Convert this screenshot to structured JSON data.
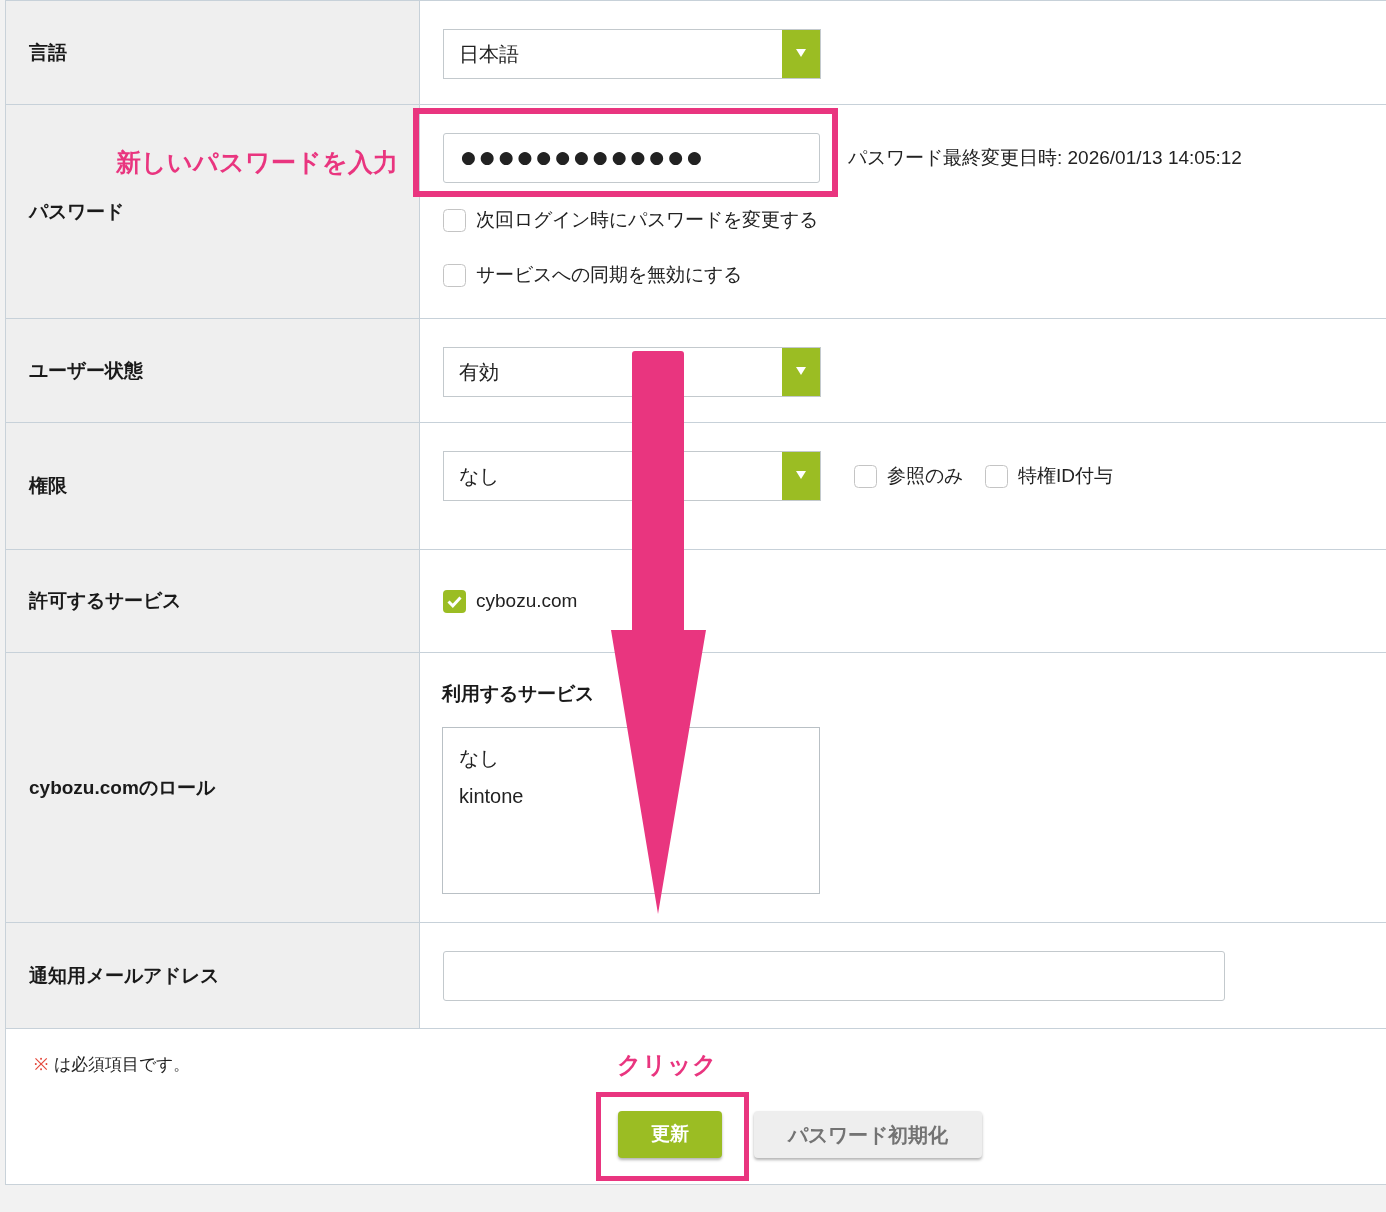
{
  "fields": [
    {
      "kind": "select",
      "label": "言語",
      "value": "日本語"
    },
    {
      "kind": "password",
      "label": "パスワード",
      "value": "●●●●●●●●●●●●●",
      "note": "パスワード最終変更日時: 2026/01/13 14:05:12",
      "options": [
        {
          "label": "次回ログイン時にパスワードを変更する",
          "checked": false
        },
        {
          "label": "サービスへの同期を無効にする",
          "checked": false
        }
      ]
    },
    {
      "kind": "select",
      "label": "ユーザー状態",
      "value": "有効"
    },
    {
      "kind": "select",
      "label": "権限",
      "value": "なし",
      "options": [
        {
          "label": "参照のみ",
          "checked": false
        },
        {
          "label": "特権ID付与",
          "checked": false
        }
      ]
    },
    {
      "kind": "checklist",
      "label": "許可するサービス",
      "options": [
        {
          "label": "cybozu.com",
          "checked": true
        }
      ]
    },
    {
      "kind": "listbox",
      "label": "cybozu.comのロール",
      "heading": "利用するサービス",
      "items": [
        {
          "label": "なし",
          "selected": false
        },
        {
          "label": "kintone",
          "selected": false
        }
      ]
    },
    {
      "kind": "text",
      "label": "通知用メールアドレス"
    }
  ],
  "footer": {
    "required_mark": "※",
    "required_note": "は必須項目です。"
  },
  "buttons": [
    {
      "kind": "primary",
      "label": "更新"
    },
    {
      "kind": "secondary",
      "label": "パスワード初期化"
    }
  ],
  "annotations": {
    "password_note": "新しいパスワードを入力",
    "click_note": "クリック"
  }
}
